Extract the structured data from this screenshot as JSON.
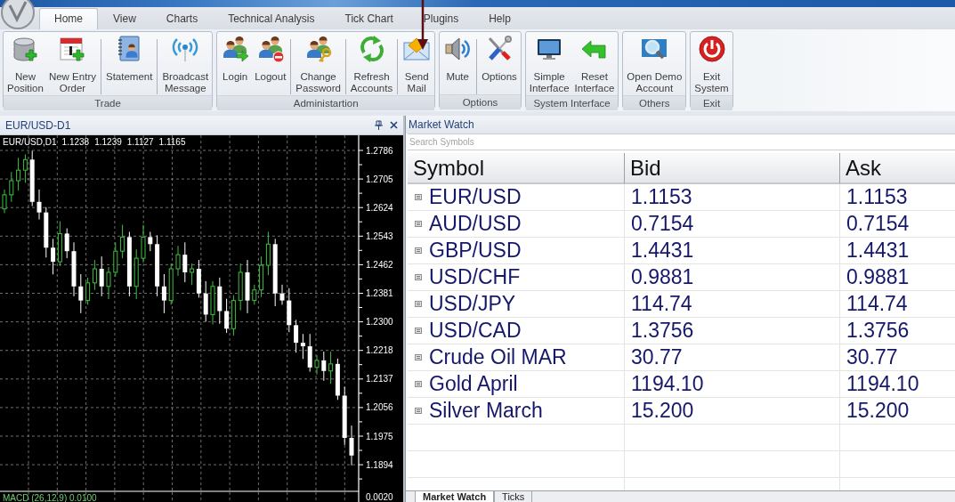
{
  "tabs": [
    {
      "label": "Home",
      "selected": true
    },
    {
      "label": "View",
      "selected": false
    },
    {
      "label": "Charts",
      "selected": false
    },
    {
      "label": "Technical Analysis",
      "selected": false
    },
    {
      "label": "Tick Chart",
      "selected": false
    },
    {
      "label": "Plugins",
      "selected": false
    },
    {
      "label": "Help",
      "selected": false
    }
  ],
  "ribbon": {
    "groups": [
      {
        "label": "Trade",
        "buttons": [
          {
            "kind": "db-add",
            "lines": [
              "New",
              "Position"
            ],
            "separator_before": false
          },
          {
            "kind": "calendar-add",
            "lines": [
              "New Entry",
              "Order"
            ],
            "separator_before": false
          },
          {
            "kind": "notebook",
            "lines": [
              "Statement"
            ],
            "separator_before": true
          },
          {
            "kind": "broadcast",
            "lines": [
              "Broadcast",
              "Message"
            ],
            "separator_before": true
          }
        ]
      },
      {
        "label": "Administartion",
        "buttons": [
          {
            "kind": "login",
            "lines": [
              "Login"
            ],
            "separator_before": false
          },
          {
            "kind": "logout",
            "lines": [
              "Logout"
            ],
            "separator_before": false
          },
          {
            "kind": "key",
            "lines": [
              "Change",
              "Password"
            ],
            "separator_before": true
          },
          {
            "kind": "refresh",
            "lines": [
              "Refresh",
              "Accounts"
            ],
            "separator_before": true
          },
          {
            "kind": "mail",
            "lines": [
              "Send",
              "Mail"
            ],
            "separator_before": true
          }
        ]
      },
      {
        "label": "Options",
        "buttons": [
          {
            "kind": "speaker",
            "lines": [
              "Mute"
            ],
            "separator_before": false
          },
          {
            "kind": "tools",
            "lines": [
              "Options"
            ],
            "separator_before": true
          }
        ]
      },
      {
        "label": "System Interface",
        "buttons": [
          {
            "kind": "monitor",
            "lines": [
              "Simple",
              "Interface"
            ],
            "separator_before": false
          },
          {
            "kind": "back",
            "lines": [
              "Reset",
              "Interface"
            ],
            "separator_before": false
          }
        ]
      },
      {
        "label": "Others",
        "buttons": [
          {
            "kind": "magnifier",
            "lines": [
              "Open Demo",
              "Account"
            ],
            "separator_before": false
          }
        ]
      },
      {
        "label": "Exit",
        "buttons": [
          {
            "kind": "power",
            "lines": [
              "Exit",
              "System"
            ],
            "separator_before": false
          }
        ]
      }
    ]
  },
  "chart_panel": {
    "title": "EUR/USD-D1",
    "info": [
      "EUR/USD,D1",
      "1.1238",
      "1.1239",
      "1.1127",
      "1.1165"
    ],
    "price_labels": [
      "1.2786",
      "1.2705",
      "1.2624",
      "1.2543",
      "1.2462",
      "1.2381",
      "1.2300",
      "1.2218",
      "1.2137",
      "1.2056",
      "1.1975",
      "1.1894"
    ],
    "indicator": "MACD (26,12,9)",
    "indicator_value": "0.0100",
    "indicator_label": "0.0020"
  },
  "market_watch": {
    "title": "Market Watch",
    "search": {
      "placeholder": "Search Symbols"
    },
    "columns": [
      "Symbol",
      "Bid",
      "Ask"
    ],
    "rows": [
      {
        "symbol": "EUR/USD",
        "bid": "1.1153",
        "ask": "1.1153"
      },
      {
        "symbol": "AUD/USD",
        "bid": "0.7154",
        "ask": "0.7154"
      },
      {
        "symbol": "GBP/USD",
        "bid": "1.4431",
        "ask": "1.4431"
      },
      {
        "symbol": "USD/CHF",
        "bid": "0.9881",
        "ask": "0.9881"
      },
      {
        "symbol": "USD/JPY",
        "bid": "114.74",
        "ask": "114.74"
      },
      {
        "symbol": "USD/CAD",
        "bid": "1.3756",
        "ask": "1.3756"
      },
      {
        "symbol": "Crude Oil MAR",
        "bid": "30.77",
        "ask": "30.77"
      },
      {
        "symbol": "Gold April",
        "bid": "1194.10",
        "ask": "1194.10"
      },
      {
        "symbol": "Silver March",
        "bid": "15.200",
        "ask": "15.200"
      }
    ],
    "tabs": [
      {
        "label": "Market Watch",
        "selected": true
      },
      {
        "label": "Ticks",
        "selected": false
      }
    ]
  }
}
